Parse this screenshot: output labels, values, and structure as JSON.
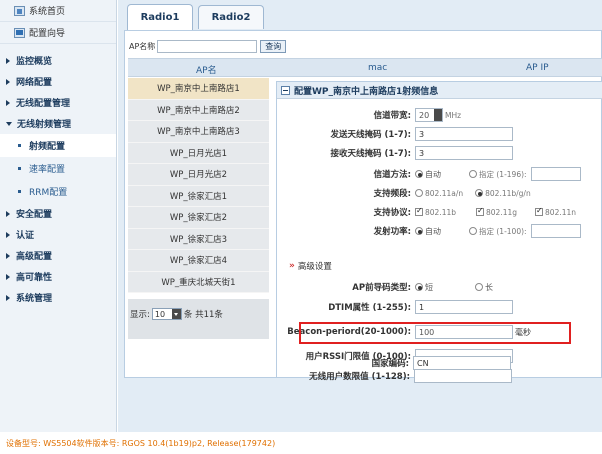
{
  "sidebar": {
    "top_items": [
      {
        "label": "系统首页",
        "icon": "home-icon"
      },
      {
        "label": "配置向导",
        "icon": "wizard-icon"
      }
    ],
    "sections": [
      {
        "label": "监控概览",
        "expanded": false
      },
      {
        "label": "网络配置",
        "expanded": false
      },
      {
        "label": "无线配置管理",
        "expanded": false
      },
      {
        "label": "无线射频管理",
        "expanded": true
      },
      {
        "label": "安全配置",
        "expanded": false
      },
      {
        "label": "认证",
        "expanded": false
      },
      {
        "label": "高级配置",
        "expanded": false
      },
      {
        "label": "高可靠性",
        "expanded": false
      },
      {
        "label": "系统管理",
        "expanded": false
      }
    ],
    "subitems": [
      {
        "label": "射频配置",
        "active": true
      },
      {
        "label": "速率配置",
        "active": false
      },
      {
        "label": "RRM配置",
        "active": false
      }
    ]
  },
  "tabs": [
    {
      "label": "Radio1",
      "active": true
    },
    {
      "label": "Radio2",
      "active": false
    }
  ],
  "search": {
    "label": "AP名称",
    "value": "",
    "button": "查询"
  },
  "table": {
    "headers": [
      "AP名",
      "mac",
      "AP IP"
    ],
    "ap_names": [
      "WP_南京中上南路店1",
      "WP_南京中上南路店2",
      "WP_南京中上南路店3",
      "WP_日月光店1",
      "WP_日月光店2",
      "WP_徐家汇店1",
      "WP_徐家汇店2",
      "WP_徐家汇店3",
      "WP_徐家汇店4",
      "WP_重庆北城天街1"
    ],
    "selected_index": 0
  },
  "pager": {
    "prefix": "显示:",
    "page_size": "10",
    "suffix": "条 共11条"
  },
  "config": {
    "title": "配置WP_南京中上南路店1射频信息",
    "channel_width": {
      "label": "信道带宽:",
      "value": "20",
      "unit": "MHz"
    },
    "tx_chain": {
      "label": "发送天线掩码 (1-7):",
      "value": "3"
    },
    "rx_chain": {
      "label": "接收天线掩码 (1-7):",
      "value": "3"
    },
    "channel_mode": {
      "label": "信道方法:",
      "opt_auto": "自动",
      "opt_manual": "指定 (1-196):",
      "value": ""
    },
    "band": {
      "label": "支持频段:",
      "opt_a": "802.11a/n",
      "opt_bgn": "802.11b/g/n"
    },
    "protocol": {
      "label": "支持协议:",
      "opt_b": "802.11b",
      "opt_g": "802.11g",
      "opt_n": "802.11n"
    },
    "tx_power": {
      "label": "发射功率:",
      "opt_auto": "自动",
      "opt_manual": "指定 (1-100):",
      "value": ""
    },
    "advanced": {
      "label": "高级设置"
    },
    "preamble": {
      "label": "AP前导码类型:",
      "opt_short": "短",
      "opt_long": "长"
    },
    "dtim": {
      "label": "DTIM属性 (1-255):",
      "value": "1"
    },
    "beacon": {
      "label": "Beacon-periord(20-1000):",
      "value": "100",
      "unit": "毫秒"
    },
    "rssi": {
      "label": "用户RSSI门限值 (0-100):",
      "value": ""
    },
    "max_users": {
      "label": "无线用户数限值 (1-128):",
      "value": ""
    },
    "country": {
      "label": "国家编码:",
      "value": "CN"
    }
  },
  "footer": {
    "text": "设备型号: WS5504软件版本号: RGOS 10.4(1b19)p2, Release(179742)"
  },
  "colors": {
    "highlight": "#e02020",
    "footer_text": "#e07000",
    "accent": "#1d3c5e"
  }
}
